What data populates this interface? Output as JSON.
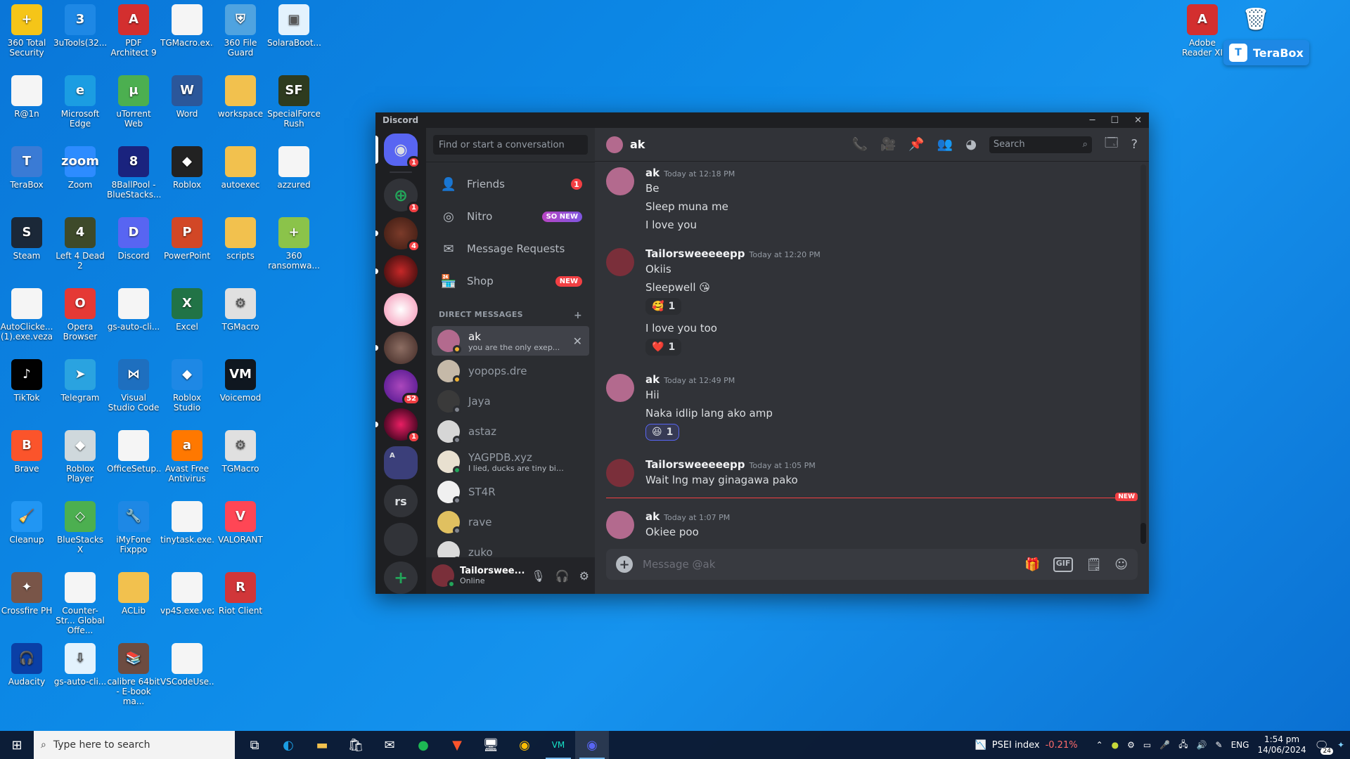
{
  "desktop_icons": [
    {
      "label": "360 Total Security",
      "color": "#f5c518",
      "glyph": "+",
      "col": 0,
      "row": 0
    },
    {
      "label": "3uTools(32...",
      "color": "#1e88e5",
      "glyph": "3",
      "col": 1,
      "row": 0
    },
    {
      "label": "PDF Architect 9",
      "color": "#d32f2f",
      "glyph": "A",
      "col": 2,
      "row": 0
    },
    {
      "label": "TGMacro.ex...",
      "color": "#f5f5f5",
      "glyph": "",
      "col": 3,
      "row": 0
    },
    {
      "label": "360 File Guard",
      "color": "#4fa3e0",
      "glyph": "⛨",
      "col": 4,
      "row": 0
    },
    {
      "label": "SolaraBoot...",
      "color": "#e3f2fd",
      "glyph": "▣",
      "col": 5,
      "row": 0
    },
    {
      "label": "R@1n",
      "color": "#f5f5f5",
      "glyph": "",
      "col": 0,
      "row": 1
    },
    {
      "label": "Microsoft Edge",
      "color": "#1b9de2",
      "glyph": "e",
      "col": 1,
      "row": 1
    },
    {
      "label": "uTorrent Web",
      "color": "#4caf50",
      "glyph": "µ",
      "col": 2,
      "row": 1
    },
    {
      "label": "Word",
      "color": "#2b579a",
      "glyph": "W",
      "col": 3,
      "row": 1
    },
    {
      "label": "workspace",
      "color": "#f2c14e",
      "glyph": "",
      "col": 4,
      "row": 1
    },
    {
      "label": "SpecialForce Rush",
      "color": "#2e3b1f",
      "glyph": "SF",
      "col": 5,
      "row": 1
    },
    {
      "label": "TeraBox",
      "color": "#3a7bd5",
      "glyph": "T",
      "col": 0,
      "row": 2
    },
    {
      "label": "Zoom",
      "color": "#2d8cff",
      "glyph": "zoom",
      "col": 1,
      "row": 2
    },
    {
      "label": "8BallPool - BlueStacks...",
      "color": "#1a237e",
      "glyph": "8",
      "col": 2,
      "row": 2
    },
    {
      "label": "Roblox",
      "color": "#222222",
      "glyph": "◆",
      "col": 3,
      "row": 2
    },
    {
      "label": "autoexec",
      "color": "#f2c14e",
      "glyph": "",
      "col": 4,
      "row": 2
    },
    {
      "label": "azzured",
      "color": "#f5f5f5",
      "glyph": "",
      "col": 5,
      "row": 2
    },
    {
      "label": "Steam",
      "color": "#1b2838",
      "glyph": "S",
      "col": 0,
      "row": 3
    },
    {
      "label": "Left 4 Dead 2",
      "color": "#3e4a2a",
      "glyph": "4",
      "col": 1,
      "row": 3
    },
    {
      "label": "Discord",
      "color": "#5865f2",
      "glyph": "D",
      "col": 2,
      "row": 3
    },
    {
      "label": "PowerPoint",
      "color": "#d24726",
      "glyph": "P",
      "col": 3,
      "row": 3
    },
    {
      "label": "scripts",
      "color": "#f2c14e",
      "glyph": "",
      "col": 4,
      "row": 3
    },
    {
      "label": "360 ransomwa...",
      "color": "#8bc34a",
      "glyph": "+",
      "col": 5,
      "row": 3
    },
    {
      "label": "AutoClicke... (1).exe.veza",
      "color": "#f5f5f5",
      "glyph": "",
      "col": 0,
      "row": 4
    },
    {
      "label": "Opera Browser",
      "color": "#e53935",
      "glyph": "O",
      "col": 1,
      "row": 4
    },
    {
      "label": "gs-auto-cli...",
      "color": "#f5f5f5",
      "glyph": "",
      "col": 2,
      "row": 4
    },
    {
      "label": "Excel",
      "color": "#217346",
      "glyph": "X",
      "col": 3,
      "row": 4
    },
    {
      "label": "TGMacro",
      "color": "#e0e0e0",
      "glyph": "⚙",
      "col": 4,
      "row": 4
    },
    {
      "label": "TikTok",
      "color": "#010101",
      "glyph": "♪",
      "col": 0,
      "row": 5
    },
    {
      "label": "Telegram",
      "color": "#2aa3e0",
      "glyph": "➤",
      "col": 1,
      "row": 5
    },
    {
      "label": "Visual Studio Code",
      "color": "#1e6fbf",
      "glyph": "⋈",
      "col": 2,
      "row": 5
    },
    {
      "label": "Roblox Studio",
      "color": "#1e88e5",
      "glyph": "◆",
      "col": 3,
      "row": 5
    },
    {
      "label": "Voicemod",
      "color": "#0f1720",
      "glyph": "VM",
      "col": 4,
      "row": 5
    },
    {
      "label": "Brave",
      "color": "#fb542b",
      "glyph": "B",
      "col": 0,
      "row": 6
    },
    {
      "label": "Roblox Player",
      "color": "#cfd8dc",
      "glyph": "◆",
      "col": 1,
      "row": 6
    },
    {
      "label": "OfficeSetup...",
      "color": "#f5f5f5",
      "glyph": "",
      "col": 2,
      "row": 6
    },
    {
      "label": "Avast Free Antivirus",
      "color": "#ff7800",
      "glyph": "a",
      "col": 3,
      "row": 6
    },
    {
      "label": "TGMacro",
      "color": "#e0e0e0",
      "glyph": "⚙",
      "col": 4,
      "row": 6
    },
    {
      "label": "Cleanup",
      "color": "#2196f3",
      "glyph": "🧹",
      "col": 0,
      "row": 7
    },
    {
      "label": "BlueStacks X",
      "color": "#4caf50",
      "glyph": "◇",
      "col": 1,
      "row": 7
    },
    {
      "label": "iMyFone Fixppo",
      "color": "#1e88e5",
      "glyph": "🔧",
      "col": 2,
      "row": 7
    },
    {
      "label": "tinytask.exe...",
      "color": "#f5f5f5",
      "glyph": "",
      "col": 3,
      "row": 7
    },
    {
      "label": "VALORANT",
      "color": "#ff4655",
      "glyph": "V",
      "col": 4,
      "row": 7
    },
    {
      "label": "Crossfire PH",
      "color": "#795548",
      "glyph": "✦",
      "col": 0,
      "row": 8
    },
    {
      "label": "Counter-Str... Global Offe...",
      "color": "#f5f5f5",
      "glyph": "",
      "col": 1,
      "row": 8
    },
    {
      "label": "ACLib",
      "color": "#f2c14e",
      "glyph": "",
      "col": 2,
      "row": 8
    },
    {
      "label": "vp4S.exe.veza",
      "color": "#f5f5f5",
      "glyph": "",
      "col": 3,
      "row": 8
    },
    {
      "label": "Riot Client",
      "color": "#d13639",
      "glyph": "R",
      "col": 4,
      "row": 8
    },
    {
      "label": "Audacity",
      "color": "#0a3fa6",
      "glyph": "🎧",
      "col": 0,
      "row": 9
    },
    {
      "label": "gs-auto-cli...",
      "color": "#e3f2fd",
      "glyph": "⇩",
      "col": 1,
      "row": 9
    },
    {
      "label": "calibre 64bit - E-book ma...",
      "color": "#6d4c41",
      "glyph": "📚",
      "col": 2,
      "row": 9
    },
    {
      "label": "VSCodeUse...",
      "color": "#f5f5f5",
      "glyph": "",
      "col": 3,
      "row": 9
    }
  ],
  "right_icons": [
    {
      "label": "Adobe Reader XI",
      "color": "#d32f2f",
      "glyph": "A"
    },
    {
      "label": "Recycle Bin",
      "color": "#b0bec5",
      "glyph": "🗑"
    }
  ],
  "terabox_pill": {
    "label": "TeraBox",
    "glyph": "T"
  },
  "discord": {
    "title": "Discord",
    "search_placeholder": "Find or start a conversation",
    "guild_badges": [
      "1",
      "1",
      "4",
      "52",
      "1"
    ],
    "guild_label_rs": "rs",
    "guild_label_a": "A",
    "nav": {
      "friends": "Friends",
      "friends_badge": "1",
      "nitro": "Nitro",
      "nitro_badge": "SO NEW",
      "message_requests": "Message Requests",
      "shop": "Shop",
      "shop_badge": "NEW"
    },
    "dm_header": "DIRECT MESSAGES",
    "dms": [
      {
        "name": "ak",
        "sub": "you are the only exep...",
        "color": "#b36a8e",
        "status": "#f0b232",
        "active": true
      },
      {
        "name": "yopops.dre",
        "sub": "",
        "color": "#c5b9a8",
        "status": "#f0b232",
        "active": false
      },
      {
        "name": "Jaya",
        "sub": "",
        "color": "#3a3a3a",
        "status": "#80848e",
        "active": false
      },
      {
        "name": "astaz",
        "sub": "",
        "color": "#d6d6d6",
        "status": "#80848e",
        "active": false
      },
      {
        "name": "YAGPDB.xyz",
        "sub": "I lied, ducks are tiny bit better...",
        "color": "#e8e0d0",
        "status": "#23a55a",
        "active": false
      },
      {
        "name": "ST4R",
        "sub": "",
        "color": "#f0f0f0",
        "status": "#80848e",
        "active": false
      },
      {
        "name": "rave",
        "sub": "",
        "color": "#e0c060",
        "status": "#80848e",
        "active": false
      },
      {
        "name": "zuko",
        "sub": "",
        "color": "#dadada",
        "status": "#80848e",
        "active": false
      }
    ],
    "user": {
      "name": "Tailorswee...",
      "status": "Online"
    },
    "chat": {
      "recipient": "ak",
      "search_placeholder": "Search",
      "composer_placeholder": "Message @ak",
      "new_label": "NEW",
      "messages": [
        {
          "author": "ak",
          "time": "Today at 12:18 PM",
          "color": "#b36a8e",
          "lines": [
            "Be",
            "Sleep muna me",
            "I love you"
          ],
          "reactions": []
        },
        {
          "author": "Tailorsweeeeepp",
          "time": "Today at 12:20 PM",
          "color": "#7a2f3a",
          "lines": [
            "Okiis",
            "Sleepwell 😘"
          ],
          "reactions": [
            {
              "emoji": "🥰",
              "count": "1",
              "me": false
            }
          ],
          "extra_lines": [
            "I love you too"
          ],
          "extra_reactions": [
            {
              "emoji": "❤️",
              "count": "1",
              "me": false
            }
          ]
        },
        {
          "author": "ak",
          "time": "Today at 12:49 PM",
          "color": "#b36a8e",
          "lines": [
            "Hii",
            "Naka idlip lang ako amp"
          ],
          "reactions": [
            {
              "emoji": "😆",
              "count": "1",
              "me": true
            }
          ]
        },
        {
          "author": "Tailorsweeeeepp",
          "time": "Today at 1:05 PM",
          "color": "#7a2f3a",
          "lines": [
            "Wait lng may ginagawa pako"
          ],
          "reactions": []
        },
        {
          "author": "ak",
          "time": "Today at 1:07 PM",
          "color": "#b36a8e",
          "lines": [
            "Okiee poo"
          ],
          "reactions": []
        }
      ]
    }
  },
  "taskbar": {
    "search_placeholder": "Type here to search",
    "psei_label": "PSEI index",
    "psei_change": "-0.21%",
    "lang": "ENG",
    "time": "1:54 pm",
    "date": "14/06/2024",
    "notifications": "24"
  }
}
